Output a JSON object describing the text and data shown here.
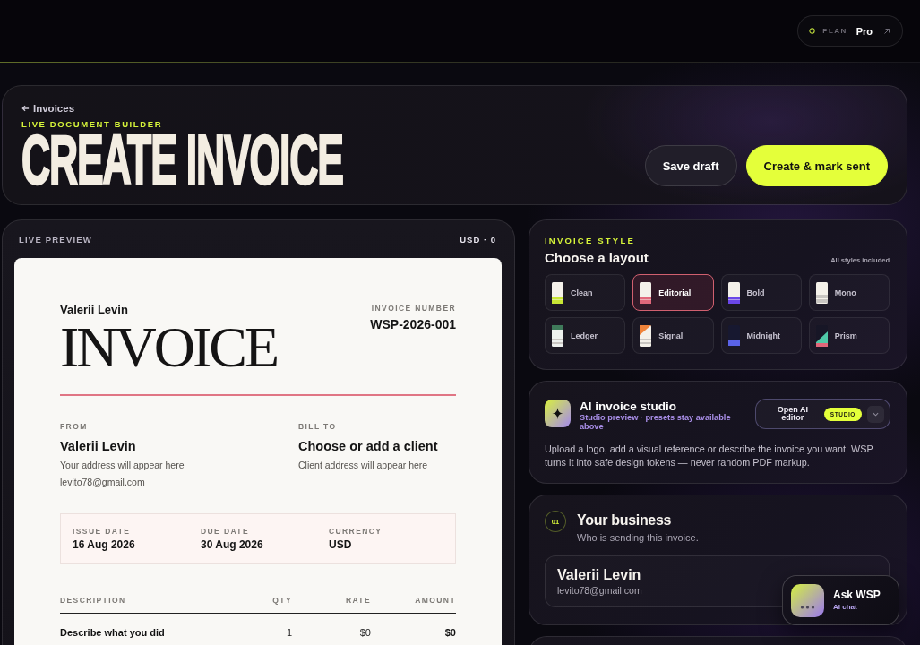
{
  "top_bar": {
    "plan_label": "PLAN",
    "plan": "Pro"
  },
  "header": {
    "back_link": "Invoices",
    "eyebrow": "LIVE DOCUMENT BUILDER",
    "title": "CREATE INVOICE",
    "buttons": [
      {
        "label": "Save draft",
        "kind": "secondary"
      },
      {
        "label": "Create & mark sent",
        "kind": "primary"
      }
    ]
  },
  "preview": {
    "label": "LIVE PREVIEW",
    "summary": "USD · 0",
    "document": {
      "sender": "Valerii Levin",
      "title": "INVOICE",
      "number_label": "INVOICE NUMBER",
      "number": "WSP-2026-001",
      "from": {
        "label": "FROM",
        "name": "Valerii Levin",
        "lines": [
          "Your address will appear here",
          "levito78@gmail.com"
        ]
      },
      "bill_to": {
        "label": "BILL TO",
        "name": "Choose or add a client",
        "lines": [
          "Client address will appear here"
        ]
      },
      "meta": [
        {
          "label": "ISSUE DATE",
          "value": "16 Aug 2026"
        },
        {
          "label": "DUE DATE",
          "value": "30 Aug 2026"
        },
        {
          "label": "CURRENCY",
          "value": "USD"
        }
      ],
      "table": {
        "columns": [
          "DESCRIPTION",
          "QTY",
          "RATE",
          "AMOUNT"
        ],
        "rows": [
          [
            "Describe what you did",
            "1",
            "$0",
            "$0"
          ]
        ]
      }
    }
  },
  "invoice_style": {
    "eyebrow": "INVOICE STYLE",
    "title": "Choose a layout",
    "note": "All styles included",
    "styles": [
      {
        "label": "Clean",
        "selected": false,
        "kind": "footer",
        "color": "#c8e635"
      },
      {
        "label": "Editorial",
        "selected": true,
        "kind": "footer",
        "color": "#e0677a"
      },
      {
        "label": "Bold",
        "selected": false,
        "kind": "footer",
        "color": "#6a46e8"
      },
      {
        "label": "Mono",
        "selected": false,
        "kind": "lines",
        "color": "#c9c6c2"
      },
      {
        "label": "Ledger",
        "selected": false,
        "kind": "header",
        "color": "#3f7a5a"
      },
      {
        "label": "Signal",
        "selected": false,
        "kind": "corner",
        "color": "#f0843a"
      },
      {
        "label": "Midnight",
        "selected": false,
        "kind": "dark",
        "color": "#5a63e8"
      },
      {
        "label": "Prism",
        "selected": false,
        "kind": "diagonal",
        "color": "#4fc9a8"
      }
    ]
  },
  "ai_studio": {
    "title": "AI invoice studio",
    "subtitle": "Studio preview · presets stay available above",
    "button": "Open AI editor",
    "badge": "STUDIO",
    "description": "Upload a logo, add a visual reference or describe the invoice you want. WSP turns it into safe design tokens — never random PDF markup."
  },
  "business": {
    "step": "01",
    "title": "Your business",
    "subtitle": "Who is sending this invoice.",
    "name": "Valerii Levin",
    "email": "levito78@gmail.com"
  },
  "assistant": {
    "title": "Ask WSP",
    "subtitle": "AI chat"
  }
}
